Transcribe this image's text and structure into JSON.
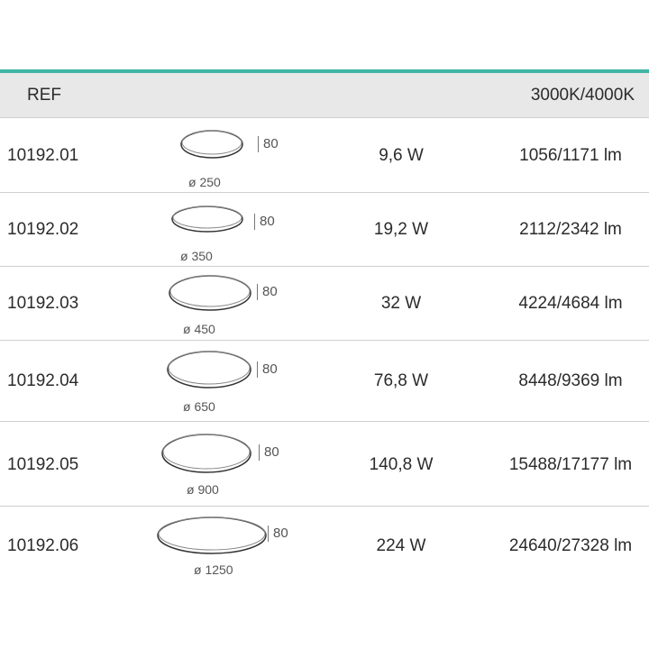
{
  "header": {
    "ref": "REF",
    "temperature": "3000K/4000K"
  },
  "colors": {
    "accent": "#3fb5a3",
    "header_bg": "#e8e8e8",
    "text": "#2b2b2b"
  },
  "rows": [
    {
      "ref": "10192.01",
      "power": "9,6 W",
      "lumen": "1056/1171 lm",
      "diameter": "ø 250",
      "height": "80"
    },
    {
      "ref": "10192.02",
      "power": "19,2 W",
      "lumen": "2112/2342 lm",
      "diameter": "ø 350",
      "height": "80"
    },
    {
      "ref": "10192.03",
      "power": "32 W",
      "lumen": "4224/4684 lm",
      "diameter": "ø 450",
      "height": "80"
    },
    {
      "ref": "10192.04",
      "power": "76,8 W",
      "lumen": "8448/9369 lm",
      "diameter": "ø 650",
      "height": "80"
    },
    {
      "ref": "10192.05",
      "power": "140,8 W",
      "lumen": "15488/17177 lm",
      "diameter": "ø 900",
      "height": "80"
    },
    {
      "ref": "10192.06",
      "power": "224 W",
      "lumen": "24640/27328 lm",
      "diameter": "ø 1250",
      "height": "80"
    }
  ]
}
